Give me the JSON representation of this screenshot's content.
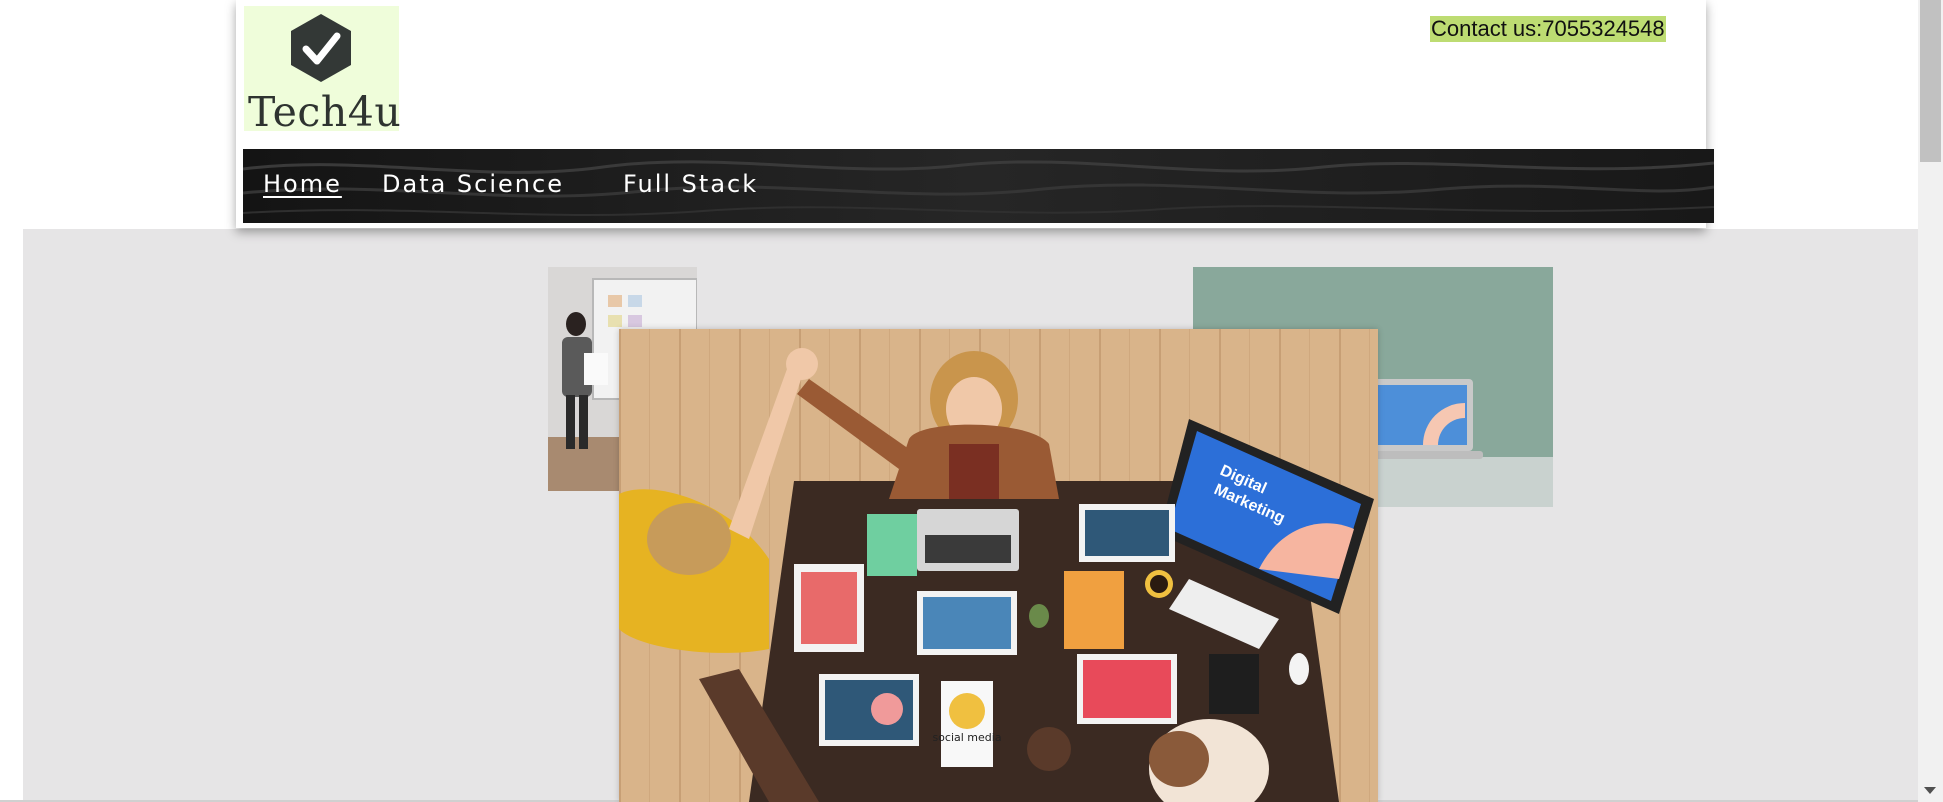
{
  "brand": {
    "name": "Tech4u",
    "logo_icon": "check-badge-icon",
    "logo_bg": "#effdda"
  },
  "header": {
    "contact_text": "Contact us:7055324548",
    "contact_bg": "#bddc72"
  },
  "nav": {
    "items": [
      {
        "label": "Home",
        "active": true
      },
      {
        "label": "Data Science",
        "active": false
      },
      {
        "label": "Full Stack",
        "active": false
      }
    ]
  },
  "gallery": {
    "images": [
      {
        "name": "presenter-photo",
        "desc": "woman presenting at whiteboard"
      },
      {
        "name": "laptop-photo",
        "desc": "laptop on green background"
      },
      {
        "name": "team-high-five-photo",
        "desc": "team high-fiving over desk"
      }
    ],
    "screen_text_1": "Digital",
    "screen_text_2": "Marketing",
    "card_text": "social media"
  },
  "colors": {
    "page_bg": "#ffffff",
    "content_bg": "#e6e5e6",
    "nav_bg": "#1b1b1b"
  }
}
